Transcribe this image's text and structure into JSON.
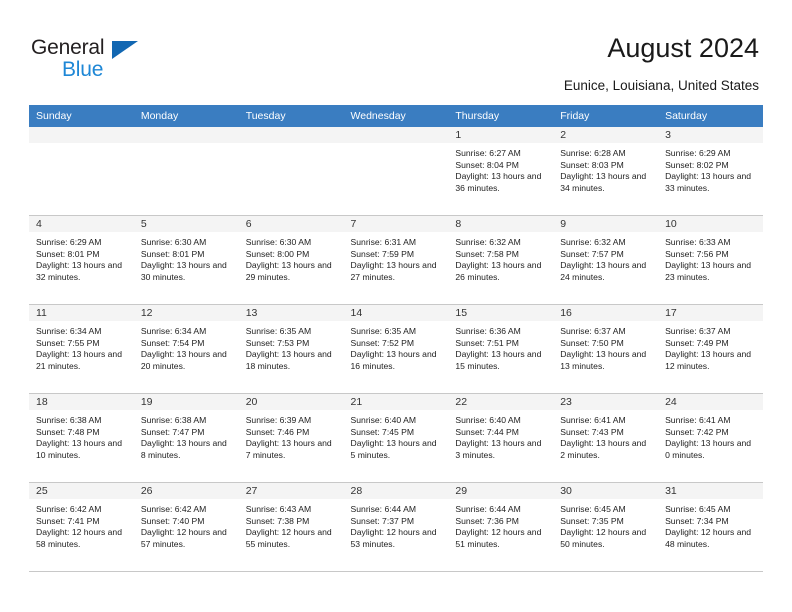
{
  "brand": {
    "name_top": "General",
    "name_bottom": "Blue",
    "triangle_color": "#1267b2",
    "blue_color": "#1e87d6"
  },
  "header": {
    "title": "August 2024",
    "subtitle": "Eunice, Louisiana, United States"
  },
  "theme": {
    "header_row_bg": "#3a7dc1",
    "daynum_band_bg": "#f4f4f4",
    "cell_border": "#c8c8c8"
  },
  "weekday_headers": [
    "Sunday",
    "Monday",
    "Tuesday",
    "Wednesday",
    "Thursday",
    "Friday",
    "Saturday"
  ],
  "weeks": [
    [
      {
        "day": "",
        "empty": true
      },
      {
        "day": "",
        "empty": true
      },
      {
        "day": "",
        "empty": true
      },
      {
        "day": "",
        "empty": true
      },
      {
        "day": "1",
        "sunrise": "Sunrise: 6:27 AM",
        "sunset": "Sunset: 8:04 PM",
        "daylight": "Daylight: 13 hours and 36 minutes."
      },
      {
        "day": "2",
        "sunrise": "Sunrise: 6:28 AM",
        "sunset": "Sunset: 8:03 PM",
        "daylight": "Daylight: 13 hours and 34 minutes."
      },
      {
        "day": "3",
        "sunrise": "Sunrise: 6:29 AM",
        "sunset": "Sunset: 8:02 PM",
        "daylight": "Daylight: 13 hours and 33 minutes."
      }
    ],
    [
      {
        "day": "4",
        "sunrise": "Sunrise: 6:29 AM",
        "sunset": "Sunset: 8:01 PM",
        "daylight": "Daylight: 13 hours and 32 minutes."
      },
      {
        "day": "5",
        "sunrise": "Sunrise: 6:30 AM",
        "sunset": "Sunset: 8:01 PM",
        "daylight": "Daylight: 13 hours and 30 minutes."
      },
      {
        "day": "6",
        "sunrise": "Sunrise: 6:30 AM",
        "sunset": "Sunset: 8:00 PM",
        "daylight": "Daylight: 13 hours and 29 minutes."
      },
      {
        "day": "7",
        "sunrise": "Sunrise: 6:31 AM",
        "sunset": "Sunset: 7:59 PM",
        "daylight": "Daylight: 13 hours and 27 minutes."
      },
      {
        "day": "8",
        "sunrise": "Sunrise: 6:32 AM",
        "sunset": "Sunset: 7:58 PM",
        "daylight": "Daylight: 13 hours and 26 minutes."
      },
      {
        "day": "9",
        "sunrise": "Sunrise: 6:32 AM",
        "sunset": "Sunset: 7:57 PM",
        "daylight": "Daylight: 13 hours and 24 minutes."
      },
      {
        "day": "10",
        "sunrise": "Sunrise: 6:33 AM",
        "sunset": "Sunset: 7:56 PM",
        "daylight": "Daylight: 13 hours and 23 minutes."
      }
    ],
    [
      {
        "day": "11",
        "sunrise": "Sunrise: 6:34 AM",
        "sunset": "Sunset: 7:55 PM",
        "daylight": "Daylight: 13 hours and 21 minutes."
      },
      {
        "day": "12",
        "sunrise": "Sunrise: 6:34 AM",
        "sunset": "Sunset: 7:54 PM",
        "daylight": "Daylight: 13 hours and 20 minutes."
      },
      {
        "day": "13",
        "sunrise": "Sunrise: 6:35 AM",
        "sunset": "Sunset: 7:53 PM",
        "daylight": "Daylight: 13 hours and 18 minutes."
      },
      {
        "day": "14",
        "sunrise": "Sunrise: 6:35 AM",
        "sunset": "Sunset: 7:52 PM",
        "daylight": "Daylight: 13 hours and 16 minutes."
      },
      {
        "day": "15",
        "sunrise": "Sunrise: 6:36 AM",
        "sunset": "Sunset: 7:51 PM",
        "daylight": "Daylight: 13 hours and 15 minutes."
      },
      {
        "day": "16",
        "sunrise": "Sunrise: 6:37 AM",
        "sunset": "Sunset: 7:50 PM",
        "daylight": "Daylight: 13 hours and 13 minutes."
      },
      {
        "day": "17",
        "sunrise": "Sunrise: 6:37 AM",
        "sunset": "Sunset: 7:49 PM",
        "daylight": "Daylight: 13 hours and 12 minutes."
      }
    ],
    [
      {
        "day": "18",
        "sunrise": "Sunrise: 6:38 AM",
        "sunset": "Sunset: 7:48 PM",
        "daylight": "Daylight: 13 hours and 10 minutes."
      },
      {
        "day": "19",
        "sunrise": "Sunrise: 6:38 AM",
        "sunset": "Sunset: 7:47 PM",
        "daylight": "Daylight: 13 hours and 8 minutes."
      },
      {
        "day": "20",
        "sunrise": "Sunrise: 6:39 AM",
        "sunset": "Sunset: 7:46 PM",
        "daylight": "Daylight: 13 hours and 7 minutes."
      },
      {
        "day": "21",
        "sunrise": "Sunrise: 6:40 AM",
        "sunset": "Sunset: 7:45 PM",
        "daylight": "Daylight: 13 hours and 5 minutes."
      },
      {
        "day": "22",
        "sunrise": "Sunrise: 6:40 AM",
        "sunset": "Sunset: 7:44 PM",
        "daylight": "Daylight: 13 hours and 3 minutes."
      },
      {
        "day": "23",
        "sunrise": "Sunrise: 6:41 AM",
        "sunset": "Sunset: 7:43 PM",
        "daylight": "Daylight: 13 hours and 2 minutes."
      },
      {
        "day": "24",
        "sunrise": "Sunrise: 6:41 AM",
        "sunset": "Sunset: 7:42 PM",
        "daylight": "Daylight: 13 hours and 0 minutes."
      }
    ],
    [
      {
        "day": "25",
        "sunrise": "Sunrise: 6:42 AM",
        "sunset": "Sunset: 7:41 PM",
        "daylight": "Daylight: 12 hours and 58 minutes."
      },
      {
        "day": "26",
        "sunrise": "Sunrise: 6:42 AM",
        "sunset": "Sunset: 7:40 PM",
        "daylight": "Daylight: 12 hours and 57 minutes."
      },
      {
        "day": "27",
        "sunrise": "Sunrise: 6:43 AM",
        "sunset": "Sunset: 7:38 PM",
        "daylight": "Daylight: 12 hours and 55 minutes."
      },
      {
        "day": "28",
        "sunrise": "Sunrise: 6:44 AM",
        "sunset": "Sunset: 7:37 PM",
        "daylight": "Daylight: 12 hours and 53 minutes."
      },
      {
        "day": "29",
        "sunrise": "Sunrise: 6:44 AM",
        "sunset": "Sunset: 7:36 PM",
        "daylight": "Daylight: 12 hours and 51 minutes."
      },
      {
        "day": "30",
        "sunrise": "Sunrise: 6:45 AM",
        "sunset": "Sunset: 7:35 PM",
        "daylight": "Daylight: 12 hours and 50 minutes."
      },
      {
        "day": "31",
        "sunrise": "Sunrise: 6:45 AM",
        "sunset": "Sunset: 7:34 PM",
        "daylight": "Daylight: 12 hours and 48 minutes."
      }
    ]
  ]
}
